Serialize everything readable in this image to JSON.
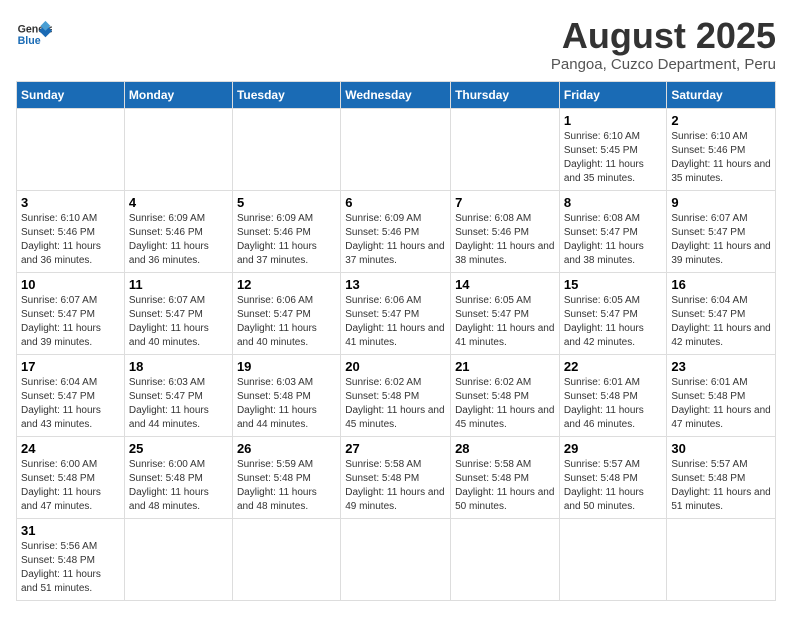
{
  "header": {
    "logo_general": "General",
    "logo_blue": "Blue",
    "title": "August 2025",
    "subtitle": "Pangoa, Cuzco Department, Peru"
  },
  "weekdays": [
    "Sunday",
    "Monday",
    "Tuesday",
    "Wednesday",
    "Thursday",
    "Friday",
    "Saturday"
  ],
  "weeks": [
    [
      {
        "day": "",
        "info": ""
      },
      {
        "day": "",
        "info": ""
      },
      {
        "day": "",
        "info": ""
      },
      {
        "day": "",
        "info": ""
      },
      {
        "day": "",
        "info": ""
      },
      {
        "day": "1",
        "info": "Sunrise: 6:10 AM\nSunset: 5:45 PM\nDaylight: 11 hours and 35 minutes."
      },
      {
        "day": "2",
        "info": "Sunrise: 6:10 AM\nSunset: 5:46 PM\nDaylight: 11 hours and 35 minutes."
      }
    ],
    [
      {
        "day": "3",
        "info": "Sunrise: 6:10 AM\nSunset: 5:46 PM\nDaylight: 11 hours and 36 minutes."
      },
      {
        "day": "4",
        "info": "Sunrise: 6:09 AM\nSunset: 5:46 PM\nDaylight: 11 hours and 36 minutes."
      },
      {
        "day": "5",
        "info": "Sunrise: 6:09 AM\nSunset: 5:46 PM\nDaylight: 11 hours and 37 minutes."
      },
      {
        "day": "6",
        "info": "Sunrise: 6:09 AM\nSunset: 5:46 PM\nDaylight: 11 hours and 37 minutes."
      },
      {
        "day": "7",
        "info": "Sunrise: 6:08 AM\nSunset: 5:46 PM\nDaylight: 11 hours and 38 minutes."
      },
      {
        "day": "8",
        "info": "Sunrise: 6:08 AM\nSunset: 5:47 PM\nDaylight: 11 hours and 38 minutes."
      },
      {
        "day": "9",
        "info": "Sunrise: 6:07 AM\nSunset: 5:47 PM\nDaylight: 11 hours and 39 minutes."
      }
    ],
    [
      {
        "day": "10",
        "info": "Sunrise: 6:07 AM\nSunset: 5:47 PM\nDaylight: 11 hours and 39 minutes."
      },
      {
        "day": "11",
        "info": "Sunrise: 6:07 AM\nSunset: 5:47 PM\nDaylight: 11 hours and 40 minutes."
      },
      {
        "day": "12",
        "info": "Sunrise: 6:06 AM\nSunset: 5:47 PM\nDaylight: 11 hours and 40 minutes."
      },
      {
        "day": "13",
        "info": "Sunrise: 6:06 AM\nSunset: 5:47 PM\nDaylight: 11 hours and 41 minutes."
      },
      {
        "day": "14",
        "info": "Sunrise: 6:05 AM\nSunset: 5:47 PM\nDaylight: 11 hours and 41 minutes."
      },
      {
        "day": "15",
        "info": "Sunrise: 6:05 AM\nSunset: 5:47 PM\nDaylight: 11 hours and 42 minutes."
      },
      {
        "day": "16",
        "info": "Sunrise: 6:04 AM\nSunset: 5:47 PM\nDaylight: 11 hours and 42 minutes."
      }
    ],
    [
      {
        "day": "17",
        "info": "Sunrise: 6:04 AM\nSunset: 5:47 PM\nDaylight: 11 hours and 43 minutes."
      },
      {
        "day": "18",
        "info": "Sunrise: 6:03 AM\nSunset: 5:47 PM\nDaylight: 11 hours and 44 minutes."
      },
      {
        "day": "19",
        "info": "Sunrise: 6:03 AM\nSunset: 5:48 PM\nDaylight: 11 hours and 44 minutes."
      },
      {
        "day": "20",
        "info": "Sunrise: 6:02 AM\nSunset: 5:48 PM\nDaylight: 11 hours and 45 minutes."
      },
      {
        "day": "21",
        "info": "Sunrise: 6:02 AM\nSunset: 5:48 PM\nDaylight: 11 hours and 45 minutes."
      },
      {
        "day": "22",
        "info": "Sunrise: 6:01 AM\nSunset: 5:48 PM\nDaylight: 11 hours and 46 minutes."
      },
      {
        "day": "23",
        "info": "Sunrise: 6:01 AM\nSunset: 5:48 PM\nDaylight: 11 hours and 47 minutes."
      }
    ],
    [
      {
        "day": "24",
        "info": "Sunrise: 6:00 AM\nSunset: 5:48 PM\nDaylight: 11 hours and 47 minutes."
      },
      {
        "day": "25",
        "info": "Sunrise: 6:00 AM\nSunset: 5:48 PM\nDaylight: 11 hours and 48 minutes."
      },
      {
        "day": "26",
        "info": "Sunrise: 5:59 AM\nSunset: 5:48 PM\nDaylight: 11 hours and 48 minutes."
      },
      {
        "day": "27",
        "info": "Sunrise: 5:58 AM\nSunset: 5:48 PM\nDaylight: 11 hours and 49 minutes."
      },
      {
        "day": "28",
        "info": "Sunrise: 5:58 AM\nSunset: 5:48 PM\nDaylight: 11 hours and 50 minutes."
      },
      {
        "day": "29",
        "info": "Sunrise: 5:57 AM\nSunset: 5:48 PM\nDaylight: 11 hours and 50 minutes."
      },
      {
        "day": "30",
        "info": "Sunrise: 5:57 AM\nSunset: 5:48 PM\nDaylight: 11 hours and 51 minutes."
      }
    ],
    [
      {
        "day": "31",
        "info": "Sunrise: 5:56 AM\nSunset: 5:48 PM\nDaylight: 11 hours and 51 minutes."
      },
      {
        "day": "",
        "info": ""
      },
      {
        "day": "",
        "info": ""
      },
      {
        "day": "",
        "info": ""
      },
      {
        "day": "",
        "info": ""
      },
      {
        "day": "",
        "info": ""
      },
      {
        "day": "",
        "info": ""
      }
    ]
  ]
}
